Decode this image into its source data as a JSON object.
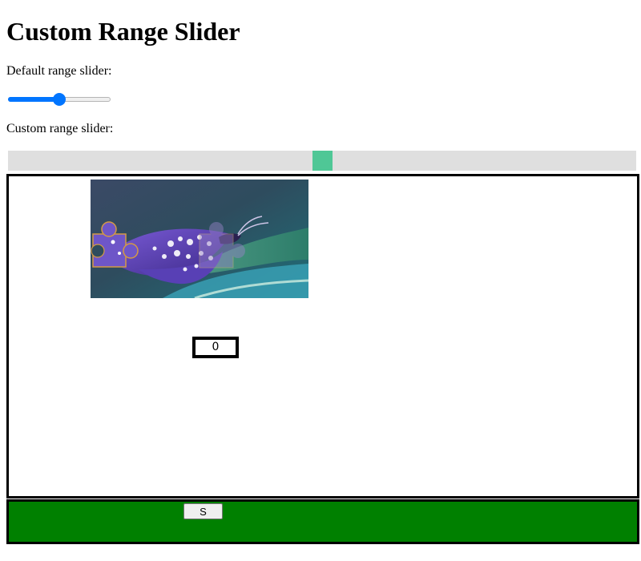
{
  "title": "Custom Range Slider",
  "default_slider": {
    "label": "Default range slider:",
    "value": 50,
    "min": 0,
    "max": 100,
    "accent_color": "#0075ff"
  },
  "custom_slider": {
    "label": "Custom range slider:",
    "value": 50,
    "min": 0,
    "max": 100,
    "track_color": "#dfdfdf",
    "thumb_color": "#4fc796"
  },
  "puzzle": {
    "image": "butterfly-photo",
    "piece_icon": "puzzle-piece-icon",
    "counter_text": "0"
  },
  "control_bar": {
    "background_color": "#008000",
    "button_label": "S"
  }
}
